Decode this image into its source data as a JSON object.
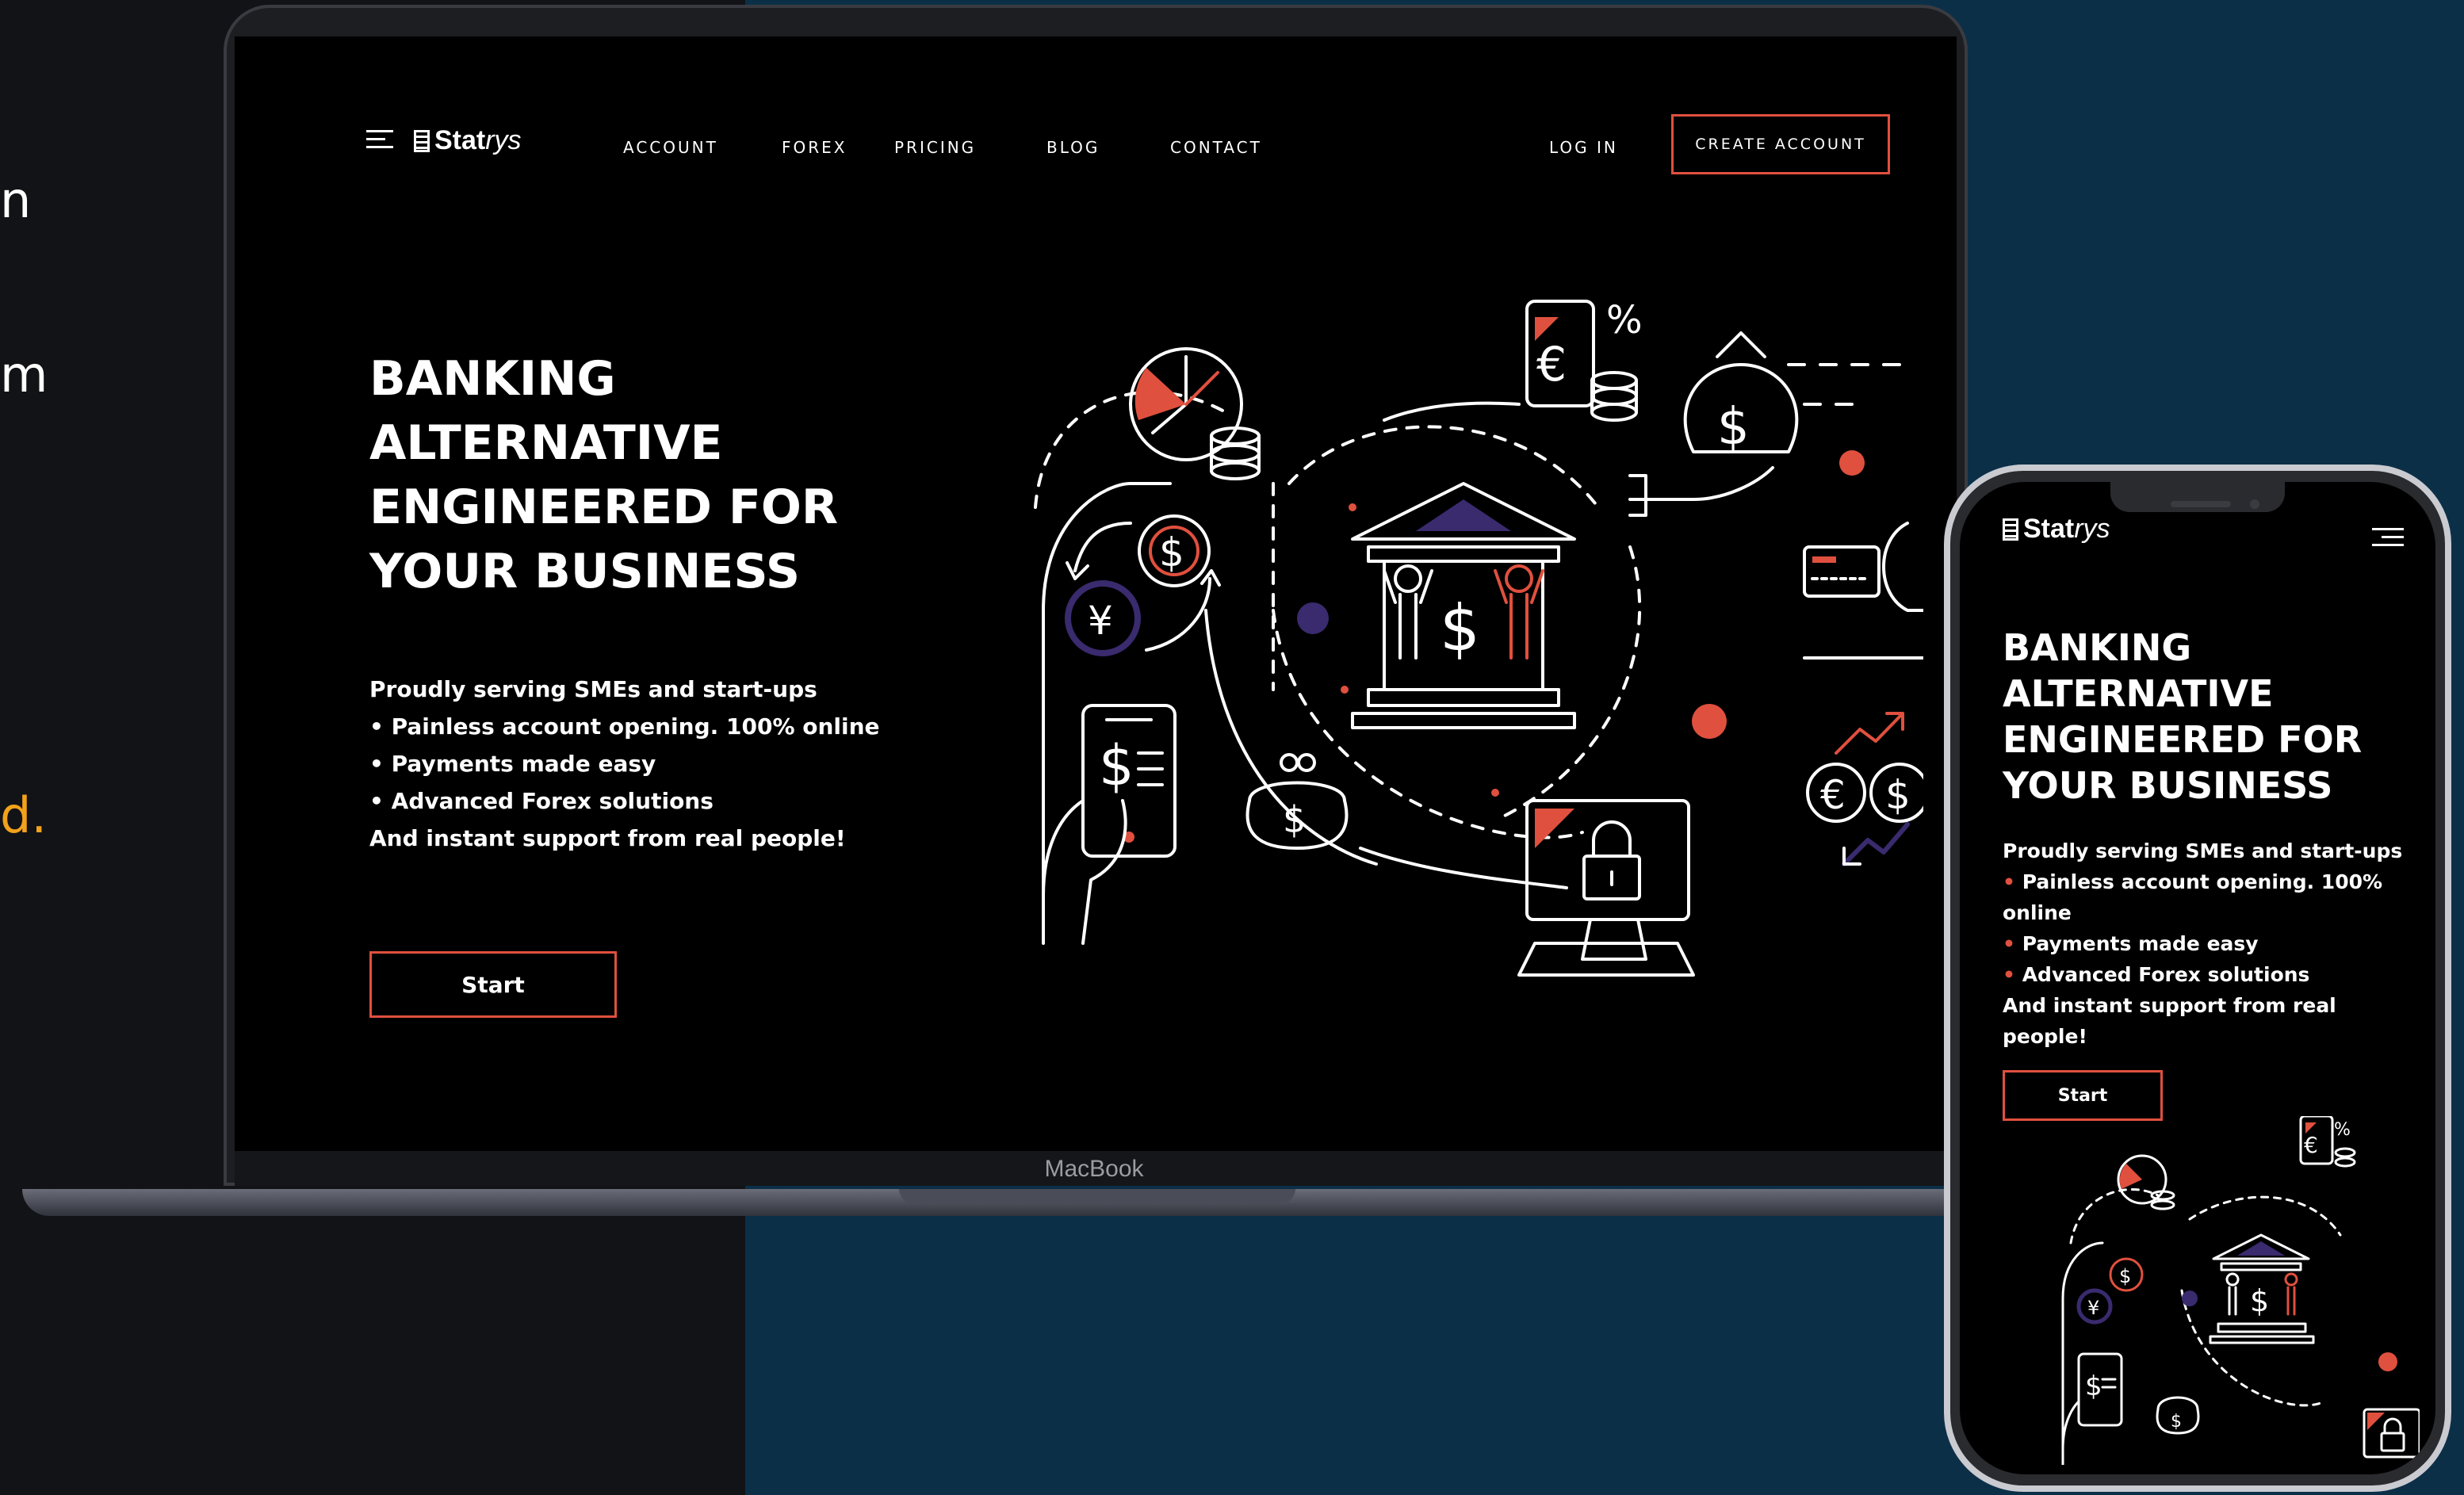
{
  "edge_text": {
    "line1": "n",
    "line2": "m",
    "line3": "d."
  },
  "laptop": {
    "label": "MacBook",
    "site": {
      "logo_bold": "Stat",
      "logo_thin": "rys",
      "nav": [
        "ACCOUNT",
        "FOREX",
        "PRICING",
        "BLOG",
        "CONTACT"
      ],
      "login": "LOG IN",
      "create_account": "CREATE ACCOUNT",
      "hero_title": "BANKING ALTERNATIVE ENGINEERED FOR YOUR BUSINESS",
      "hero_lines": [
        "Proudly serving SMEs and start-ups",
        "• Painless account opening. 100% online",
        "• Payments made easy",
        "• Advanced Forex solutions",
        "And instant support from real people!"
      ],
      "start": "Start"
    }
  },
  "phone": {
    "logo_bold": "Stat",
    "logo_thin": "rys",
    "hero_title": "BANKING ALTERNATIVE ENGINEERED FOR YOUR BUSINESS",
    "intro": "Proudly serving SMEs and start-ups",
    "bullets": [
      "Painless account opening. 100% online",
      "Payments made easy",
      "Advanced Forex solutions"
    ],
    "outro": "And instant support from real people!",
    "bullet_char": "•",
    "start": "Start"
  },
  "illustration_symbols": {
    "dollar": "$",
    "yen": "¥",
    "euro": "€",
    "percent": "%"
  },
  "colors": {
    "accent": "#e0503e",
    "purple": "#3a2a6e",
    "orange_text": "#f2a21b",
    "navy_bg": "#0c2f48"
  }
}
